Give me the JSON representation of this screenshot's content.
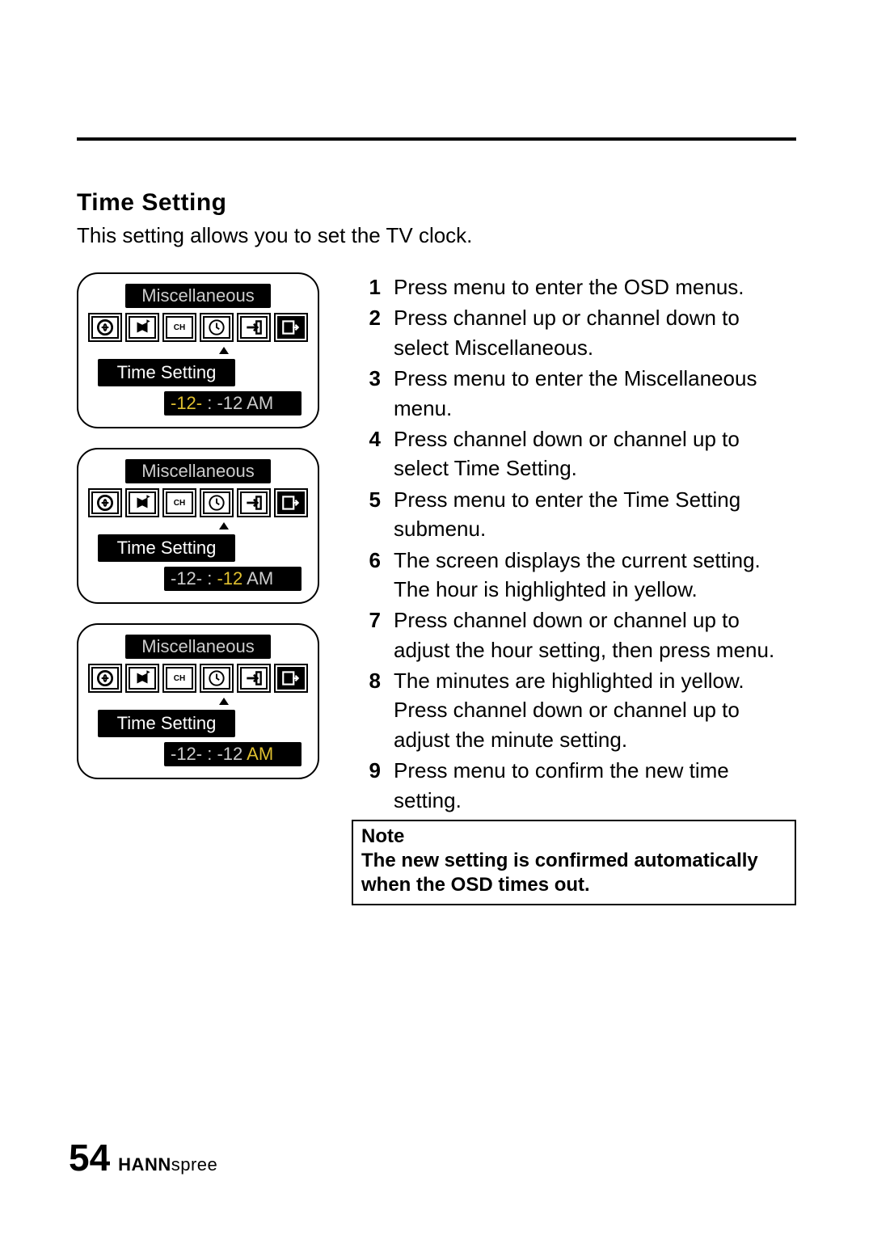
{
  "section_title": "Time Setting",
  "intro": "This setting allows you to set the TV clock.",
  "osd": {
    "title": "Miscellaneous",
    "label": "Time Setting",
    "hour": "-12-",
    "sep": " : ",
    "minute": "-12",
    "ampm": " AM"
  },
  "steps": [
    "Press menu to enter the OSD menus.",
    "Press channel up or channel down to select Miscellaneous.",
    "Press menu to enter the Miscellaneous menu.",
    "Press channel down or channel up to select Time Setting.",
    "Press menu to enter the Time Setting submenu.",
    "The screen displays the current setting. The hour is highlighted in yellow.",
    "Press channel down or channel up to adjust the hour setting, then press menu.",
    "The minutes are highlighted in yellow. Press channel down or channel up to adjust the minute setting.",
    "Press menu to confirm the new time setting."
  ],
  "note": {
    "label": "Note",
    "body": "The new setting is confirmed automatically when the OSD times out."
  },
  "footer": {
    "page": "54",
    "brand_bold": "HANN",
    "brand_rest": "spree"
  }
}
